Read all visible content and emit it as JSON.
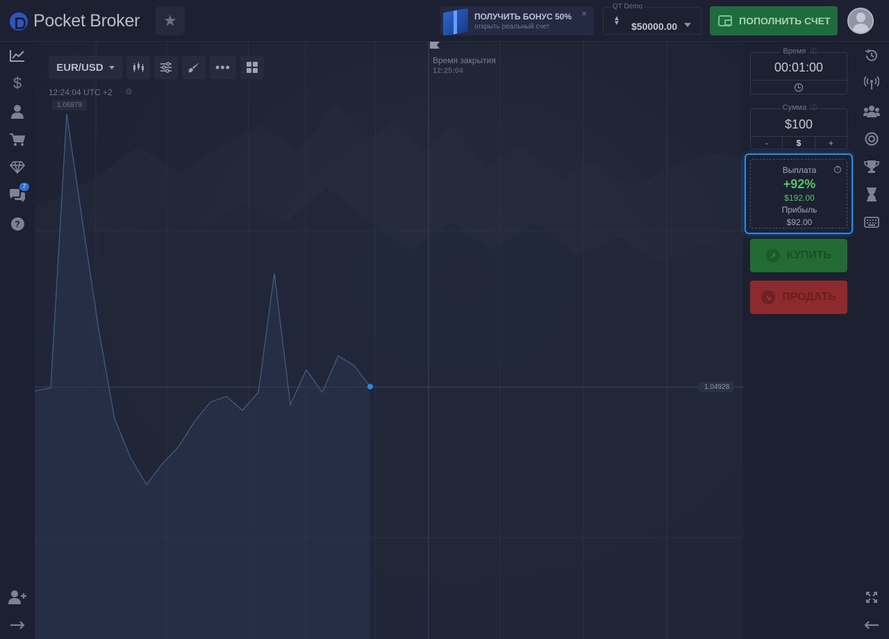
{
  "header": {
    "logo_text": "Pocket Broker",
    "bonus": {
      "title": "ПОЛУЧИТЬ БОНУС 50%",
      "subtitle": "открыть реальный счет",
      "close": "×"
    },
    "account": {
      "label": "QT Demo",
      "balance": "$50000.00"
    },
    "deposit_label": "ПОПОЛНИТЬ СЧЕТ"
  },
  "left_nav": {
    "chat_badge": "7"
  },
  "chart": {
    "pair": "EUR/USD",
    "clock": "12:24:04 UTC +2",
    "close_time_label": "Время закрытия",
    "close_time_value": "12:25:04",
    "current_price": "1.04928",
    "max_price": "1.06879",
    "accent": "#1e90f0",
    "line_color": "#3e5d84"
  },
  "chart_data": {
    "type": "area",
    "series": [
      {
        "values": [
          1.049,
          1.0492,
          1.0688,
          1.061,
          1.0534,
          1.047,
          1.0442,
          1.0423,
          1.0438,
          1.045,
          1.0468,
          1.0482,
          1.0486,
          1.0476,
          1.0489,
          1.0574,
          1.048,
          1.0505,
          1.0489,
          1.0515,
          1.0508,
          1.0493
        ]
      }
    ]
  },
  "trade_panel": {
    "time_label": "Время",
    "time_value": "00:01:00",
    "amount_label": "Сумма",
    "amount_value": "$100",
    "amount_minus": "-",
    "amount_currency": "$",
    "amount_plus": "+",
    "payout_label": "Выплата",
    "payout_help": "?",
    "payout_percent": "+92%",
    "payout_amount": "$192.00",
    "profit_label": "Прибыль",
    "profit_value": "$92.00",
    "buy_label": "КУПИТЬ",
    "sell_label": "ПРОДАТЬ"
  }
}
